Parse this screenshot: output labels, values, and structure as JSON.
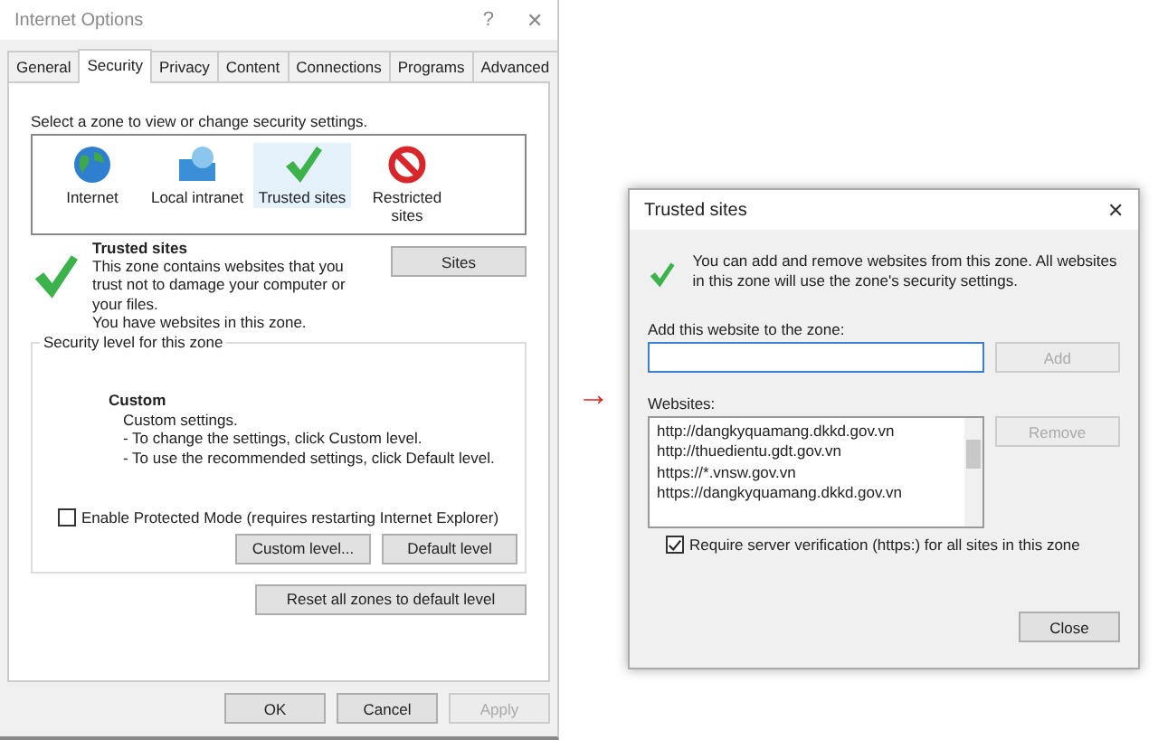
{
  "left_window": {
    "title": "Internet Options",
    "help": "?",
    "close": "✕",
    "tabs": [
      {
        "label": "General",
        "selected": false
      },
      {
        "label": "Security",
        "selected": true
      },
      {
        "label": "Privacy",
        "selected": false
      },
      {
        "label": "Content",
        "selected": false
      },
      {
        "label": "Connections",
        "selected": false
      },
      {
        "label": "Programs",
        "selected": false
      },
      {
        "label": "Advanced",
        "selected": false
      }
    ],
    "zone_prompt": "Select a zone to view or change security settings.",
    "zones": [
      {
        "kind": "globe",
        "label": "Internet",
        "selected": false
      },
      {
        "kind": "intranet",
        "label": "Local intranet",
        "selected": false
      },
      {
        "kind": "check",
        "label": "Trusted sites",
        "selected": true
      },
      {
        "kind": "blocked",
        "label": "Restricted sites",
        "selected": false
      }
    ],
    "zone_title": "Trusted sites",
    "zone_description": "This zone contains websites that you trust not to damage your computer or your files.",
    "zone_note": "You have websites in this zone.",
    "sites_button": "Sites",
    "level_group": "Security level for this zone",
    "level_title": "Custom",
    "level_lines": [
      "Custom settings.",
      "- To change the settings, click Custom level.",
      "- To use the recommended settings, click Default level."
    ],
    "protected_mode": {
      "label": "Enable Protected Mode (requires restarting Internet Explorer)",
      "checked": false
    },
    "level_buttons": [
      {
        "label": "Custom level...",
        "disabled": false
      },
      {
        "label": "Default level",
        "disabled": false
      }
    ],
    "reset_button": "Reset all zones to default level",
    "buttons": [
      {
        "label": "OK",
        "disabled": false
      },
      {
        "label": "Cancel",
        "disabled": false
      },
      {
        "label": "Apply",
        "disabled": true
      }
    ]
  },
  "arrow": "→",
  "right_window": {
    "title": "Trusted sites",
    "close": "✕",
    "info": "You can add and remove websites from this zone. All websites in this zone will use the zone's security settings.",
    "add_label": "Add this website to the zone:",
    "add_button": {
      "label": "Add",
      "disabled": true
    },
    "websites_label": "Websites:",
    "websites": [
      "http://dangkyquamang.dkkd.gov.vn",
      "http://thuedientu.gdt.gov.vn",
      "https://*.vnsw.gov.vn",
      "https://dangkyquamang.dkkd.gov.vn"
    ],
    "remove_button": {
      "label": "Remove",
      "disabled": true
    },
    "verify": {
      "label": "Require server verification (https:) for all sites in this zone",
      "checked": true
    },
    "close_button": "Close"
  }
}
